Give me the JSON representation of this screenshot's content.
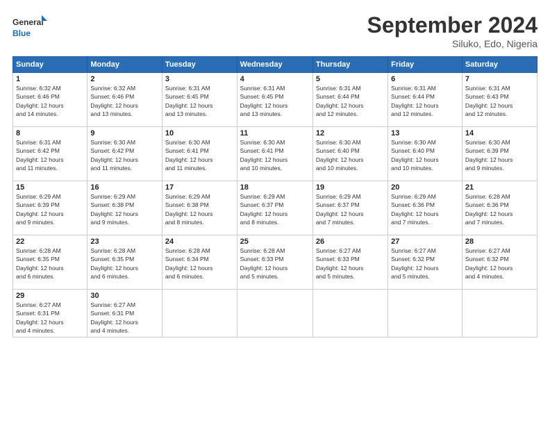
{
  "logo": {
    "line1": "General",
    "line2": "Blue"
  },
  "header": {
    "month": "September 2024",
    "location": "Siluko, Edo, Nigeria"
  },
  "days_header": [
    "Sunday",
    "Monday",
    "Tuesday",
    "Wednesday",
    "Thursday",
    "Friday",
    "Saturday"
  ],
  "weeks": [
    [
      {
        "day": "1",
        "sunrise": "6:32 AM",
        "sunset": "6:46 PM",
        "daylight": "12 hours and 14 minutes."
      },
      {
        "day": "2",
        "sunrise": "6:32 AM",
        "sunset": "6:46 PM",
        "daylight": "12 hours and 13 minutes."
      },
      {
        "day": "3",
        "sunrise": "6:31 AM",
        "sunset": "6:45 PM",
        "daylight": "12 hours and 13 minutes."
      },
      {
        "day": "4",
        "sunrise": "6:31 AM",
        "sunset": "6:45 PM",
        "daylight": "12 hours and 13 minutes."
      },
      {
        "day": "5",
        "sunrise": "6:31 AM",
        "sunset": "6:44 PM",
        "daylight": "12 hours and 12 minutes."
      },
      {
        "day": "6",
        "sunrise": "6:31 AM",
        "sunset": "6:44 PM",
        "daylight": "12 hours and 12 minutes."
      },
      {
        "day": "7",
        "sunrise": "6:31 AM",
        "sunset": "6:43 PM",
        "daylight": "12 hours and 12 minutes."
      }
    ],
    [
      {
        "day": "8",
        "sunrise": "6:31 AM",
        "sunset": "6:42 PM",
        "daylight": "12 hours and 11 minutes."
      },
      {
        "day": "9",
        "sunrise": "6:30 AM",
        "sunset": "6:42 PM",
        "daylight": "12 hours and 11 minutes."
      },
      {
        "day": "10",
        "sunrise": "6:30 AM",
        "sunset": "6:41 PM",
        "daylight": "12 hours and 11 minutes."
      },
      {
        "day": "11",
        "sunrise": "6:30 AM",
        "sunset": "6:41 PM",
        "daylight": "12 hours and 10 minutes."
      },
      {
        "day": "12",
        "sunrise": "6:30 AM",
        "sunset": "6:40 PM",
        "daylight": "12 hours and 10 minutes."
      },
      {
        "day": "13",
        "sunrise": "6:30 AM",
        "sunset": "6:40 PM",
        "daylight": "12 hours and 10 minutes."
      },
      {
        "day": "14",
        "sunrise": "6:30 AM",
        "sunset": "6:39 PM",
        "daylight": "12 hours and 9 minutes."
      }
    ],
    [
      {
        "day": "15",
        "sunrise": "6:29 AM",
        "sunset": "6:39 PM",
        "daylight": "12 hours and 9 minutes."
      },
      {
        "day": "16",
        "sunrise": "6:29 AM",
        "sunset": "6:38 PM",
        "daylight": "12 hours and 9 minutes."
      },
      {
        "day": "17",
        "sunrise": "6:29 AM",
        "sunset": "6:38 PM",
        "daylight": "12 hours and 8 minutes."
      },
      {
        "day": "18",
        "sunrise": "6:29 AM",
        "sunset": "6:37 PM",
        "daylight": "12 hours and 8 minutes."
      },
      {
        "day": "19",
        "sunrise": "6:29 AM",
        "sunset": "6:37 PM",
        "daylight": "12 hours and 7 minutes."
      },
      {
        "day": "20",
        "sunrise": "6:29 AM",
        "sunset": "6:36 PM",
        "daylight": "12 hours and 7 minutes."
      },
      {
        "day": "21",
        "sunrise": "6:28 AM",
        "sunset": "6:36 PM",
        "daylight": "12 hours and 7 minutes."
      }
    ],
    [
      {
        "day": "22",
        "sunrise": "6:28 AM",
        "sunset": "6:35 PM",
        "daylight": "12 hours and 6 minutes."
      },
      {
        "day": "23",
        "sunrise": "6:28 AM",
        "sunset": "6:35 PM",
        "daylight": "12 hours and 6 minutes."
      },
      {
        "day": "24",
        "sunrise": "6:28 AM",
        "sunset": "6:34 PM",
        "daylight": "12 hours and 6 minutes."
      },
      {
        "day": "25",
        "sunrise": "6:28 AM",
        "sunset": "6:33 PM",
        "daylight": "12 hours and 5 minutes."
      },
      {
        "day": "26",
        "sunrise": "6:27 AM",
        "sunset": "6:33 PM",
        "daylight": "12 hours and 5 minutes."
      },
      {
        "day": "27",
        "sunrise": "6:27 AM",
        "sunset": "6:32 PM",
        "daylight": "12 hours and 5 minutes."
      },
      {
        "day": "28",
        "sunrise": "6:27 AM",
        "sunset": "6:32 PM",
        "daylight": "12 hours and 4 minutes."
      }
    ],
    [
      {
        "day": "29",
        "sunrise": "6:27 AM",
        "sunset": "6:31 PM",
        "daylight": "12 hours and 4 minutes."
      },
      {
        "day": "30",
        "sunrise": "6:27 AM",
        "sunset": "6:31 PM",
        "daylight": "12 hours and 4 minutes."
      },
      null,
      null,
      null,
      null,
      null
    ]
  ],
  "labels": {
    "sunrise": "Sunrise:",
    "sunset": "Sunset:",
    "daylight": "Daylight:"
  }
}
